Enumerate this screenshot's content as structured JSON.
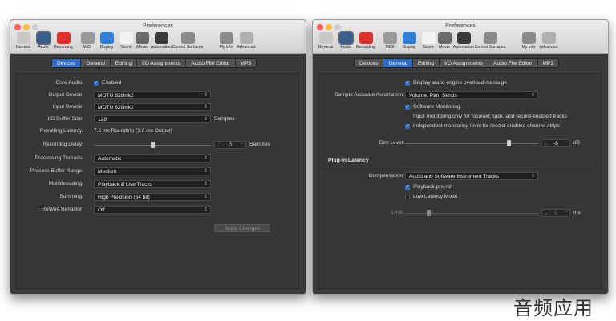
{
  "window_title": "Preferences",
  "toolbar": [
    {
      "label": "General",
      "icon": "general-icon",
      "color": "#c8c8c8"
    },
    {
      "label": "Audio",
      "icon": "audio-icon",
      "color": "#3a5f8a",
      "selected": true
    },
    {
      "label": "Recording",
      "icon": "record-icon",
      "color": "#e0302b"
    },
    {
      "label": "MIDI",
      "icon": "midi-icon",
      "color": "#9a9a9a"
    },
    {
      "label": "Display",
      "icon": "display-icon",
      "color": "#2f7fd6"
    },
    {
      "label": "Score",
      "icon": "score-icon",
      "color": "#f2f2f2"
    },
    {
      "label": "Movie",
      "icon": "movie-icon",
      "color": "#6a6a6a"
    },
    {
      "label": "Automation",
      "icon": "automation-icon",
      "color": "#3a3a3a"
    },
    {
      "label": "Control Surfaces",
      "icon": "control-surfaces-icon",
      "color": "#8a8a8a"
    },
    {
      "label": "My Info",
      "icon": "my-info-icon",
      "color": "#8a8a8a"
    },
    {
      "label": "Advanced",
      "icon": "advanced-icon",
      "color": "#b0b0b0"
    }
  ],
  "tabs": [
    "Devices",
    "General",
    "Editing",
    "I/O Assignments",
    "Audio File Editor",
    "MP3"
  ],
  "left": {
    "active_tab": 0,
    "core_audio": {
      "label": "Core Audio:",
      "value": "Enabled"
    },
    "output_device": {
      "label": "Output Device:",
      "value": "MOTU 828mk2"
    },
    "input_device": {
      "label": "Input Device:",
      "value": "MOTU 828mk2"
    },
    "io_buffer": {
      "label": "I/O Buffer Size:",
      "value": "128",
      "unit": "Samples"
    },
    "resulting_latency": {
      "label": "Resulting Latency:",
      "value": "7.2 ms Roundtrip (3.6 ms Output)"
    },
    "recording_delay": {
      "label": "Recording Delay:",
      "value": "0",
      "unit": "Samples",
      "level": 0.5
    },
    "processing_threads": {
      "label": "Processing Threads:",
      "value": "Automatic"
    },
    "process_buffer": {
      "label": "Process Buffer Range:",
      "value": "Medium"
    },
    "multithreading": {
      "label": "Multithreading:",
      "value": "Playback & Live Tracks"
    },
    "summing": {
      "label": "Summing:",
      "value": "High Precision (64 bit)"
    },
    "rewire": {
      "label": "ReWire Behavior:",
      "value": "Off"
    },
    "apply_button": "Apply Changes"
  },
  "right": {
    "active_tab": 1,
    "overload_msg": "Display audio engine overload message",
    "sample_accurate": {
      "label": "Sample Accurate Automation:",
      "value": "Volume, Pan, Sends"
    },
    "software_monitoring": "Software Monitoring",
    "focused_track_monitoring": "Input monitoring only for focused track, and record-enabled tracks",
    "independent_monitoring": "Independent monitoring level for record-enabled channel strips",
    "dim_level": {
      "label": "Dim Level:",
      "value": "-8",
      "unit": "dB",
      "level": 0.78
    },
    "plugin_latency_title": "Plug-in Latency",
    "compensation": {
      "label": "Compensation:",
      "value": "Audio and Software Instrument Tracks"
    },
    "playback_preroll": "Playback pre-roll",
    "low_latency": "Low Latency Mode",
    "limit": {
      "label": "Limit:",
      "value": "5",
      "unit": "ms",
      "level": 0.18
    }
  },
  "watermark": "音频应用"
}
